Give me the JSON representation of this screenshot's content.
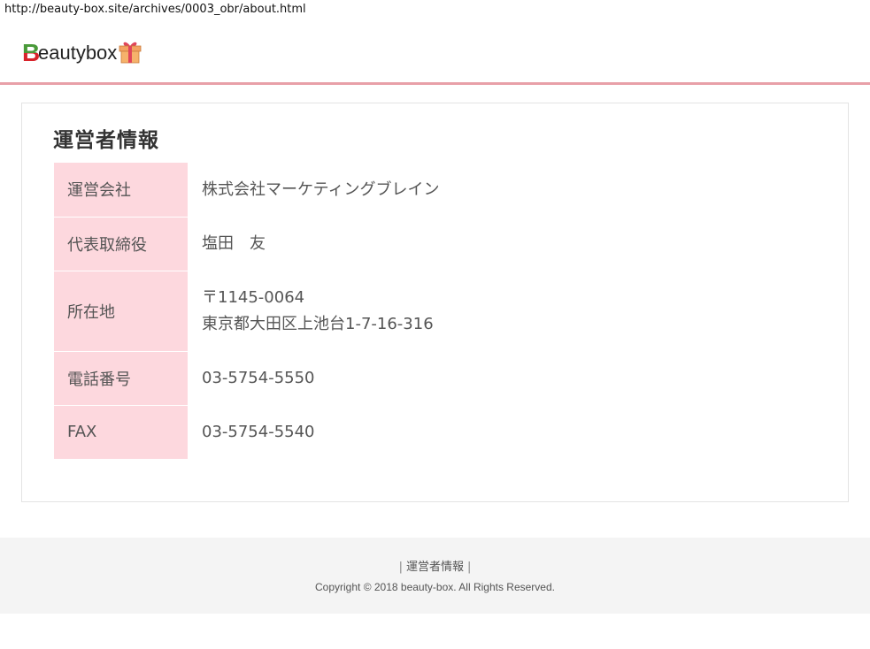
{
  "browser": {
    "url": "http://beauty-box.site/archives/0003_obr/about.html"
  },
  "header": {
    "logo_initial": "B",
    "logo_text": "eautybox",
    "logo_icon": "gift-icon",
    "accent_color": "#e8a0a8"
  },
  "main": {
    "title": "運営者情報",
    "rows": [
      {
        "label": "運営会社",
        "value_lines": [
          "株式会社マーケティングブレイン"
        ]
      },
      {
        "label": "代表取締役",
        "value_lines": [
          "塩田　友"
        ]
      },
      {
        "label": "所在地",
        "value_lines": [
          "〒1145-0064",
          "東京都大田区上池台1-7-16-316"
        ]
      },
      {
        "label": "電話番号",
        "value_lines": [
          "03-5754-5550"
        ]
      },
      {
        "label": "FAX",
        "value_lines": [
          "03-5754-5540"
        ]
      }
    ],
    "label_bg_color": "#fdd8de"
  },
  "footer": {
    "sep_left": "|",
    "nav_link": "運営者情報",
    "sep_right": "|",
    "copyright": "Copyright © 2018 beauty-box. All Rights Reserved."
  }
}
